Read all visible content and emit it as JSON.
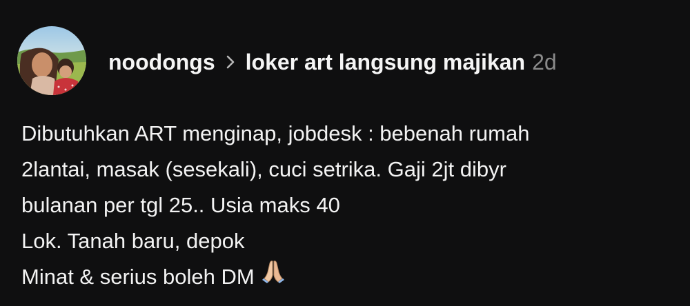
{
  "post": {
    "username": "noodongs",
    "thread": "loker art langsung majikan",
    "time": "2d",
    "lines": [
      "Dibutuhkan ART menginap, jobdesk : bebenah rumah",
      "2lantai, masak (sesekali), cuci setrika. Gaji 2jt dibyr",
      "bulanan per tgl 25.. Usia maks 40",
      "Lok. Tanah baru, depok",
      "Minat & serius boleh DM"
    ],
    "end_emoji": "folded-hands-icon"
  },
  "colors": {
    "background": "#0f0f10",
    "text": "#f2f2f2",
    "muted": "#8a8a8a"
  }
}
